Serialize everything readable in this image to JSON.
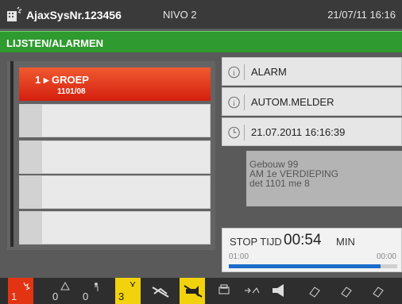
{
  "titlebar": {
    "system": "AjaxSysNr.123456",
    "level": "NIVO 2",
    "datetime": "21/07/11 16:16"
  },
  "section": {
    "title": "LIJSTEN/ALARMEN"
  },
  "list": {
    "selected": {
      "line1": "1 ▸ GROEP",
      "line2": "1101/08"
    }
  },
  "details": {
    "type": "ALARM",
    "source": "AUTOM.MELDER",
    "time": "21.07.2011 16:16:39",
    "location": [
      "Gebouw 99",
      "AM 1e VERDIEPING",
      "det 1101 me 8"
    ]
  },
  "stop": {
    "label": "STOP TIJD",
    "value": "00:54",
    "unit": "MIN",
    "start": "01:00",
    "end": "00:00",
    "remaining_fraction": 0.9
  },
  "bottom": {
    "counts": [
      "1",
      "0",
      "0",
      "3"
    ]
  },
  "colors": {
    "accent_green": "#2f9a2f",
    "alarm_red": "#e23412",
    "warning_yellow": "#f2d20c",
    "progress_blue": "#1b6cc9"
  }
}
